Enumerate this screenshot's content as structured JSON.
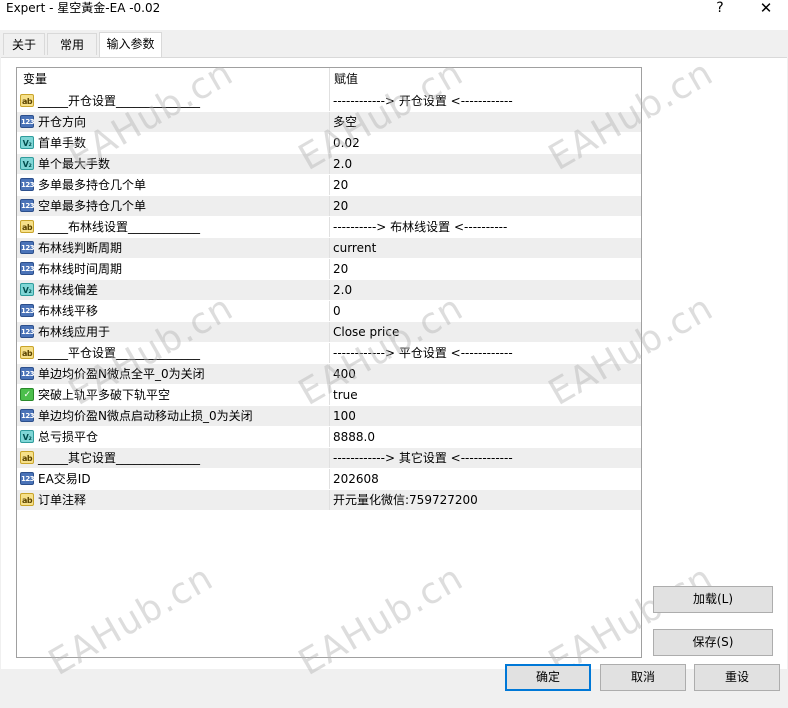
{
  "window": {
    "title": "Expert - 星空黃金-EA -0.02",
    "help_label": "?",
    "close_label": "✕"
  },
  "tabs": [
    {
      "label": "关于"
    },
    {
      "label": "常用"
    },
    {
      "label": "输入参数"
    }
  ],
  "grid": {
    "col_variable": "变量",
    "col_value": "赋值",
    "rows": [
      {
        "type": "ab",
        "icon_text": "ab",
        "name": "_____开仓设置______________",
        "value": "------------> 开仓设置 <------------"
      },
      {
        "type": "123",
        "icon_text": "123",
        "name": "开仓方向",
        "value": "多空"
      },
      {
        "type": "double",
        "icon_text": "V₂",
        "name": "首单手数",
        "value": "0.02"
      },
      {
        "type": "double",
        "icon_text": "V₂",
        "name": "单个最大手数",
        "value": "2.0"
      },
      {
        "type": "123",
        "icon_text": "123",
        "name": "多单最多持仓几个单",
        "value": "20"
      },
      {
        "type": "123",
        "icon_text": "123",
        "name": "空单最多持仓几个单",
        "value": "20"
      },
      {
        "type": "ab",
        "icon_text": "ab",
        "name": "_____布林线设置____________",
        "value": "----------> 布林线设置 <----------"
      },
      {
        "type": "123",
        "icon_text": "123",
        "name": "布林线判断周期",
        "value": "current"
      },
      {
        "type": "123",
        "icon_text": "123",
        "name": "布林线时间周期",
        "value": "20"
      },
      {
        "type": "double",
        "icon_text": "V₂",
        "name": "布林线偏差",
        "value": "2.0"
      },
      {
        "type": "123",
        "icon_text": "123",
        "name": "布林线平移",
        "value": "0"
      },
      {
        "type": "123",
        "icon_text": "123",
        "name": "布林线应用于",
        "value": "Close price"
      },
      {
        "type": "ab",
        "icon_text": "ab",
        "name": "_____平仓设置______________",
        "value": "------------> 平仓设置 <------------"
      },
      {
        "type": "123",
        "icon_text": "123",
        "name": "单边均价盈N微点全平_0为关闭",
        "value": "400"
      },
      {
        "type": "bool",
        "icon_text": "✓",
        "name": "突破上轨平多破下轨平空",
        "value": "true"
      },
      {
        "type": "123",
        "icon_text": "123",
        "name": "单边均价盈N微点启动移动止损_0为关闭",
        "value": "100"
      },
      {
        "type": "double",
        "icon_text": "V₂",
        "name": "总亏损平仓",
        "value": "8888.0"
      },
      {
        "type": "ab",
        "icon_text": "ab",
        "name": "_____其它设置______________",
        "value": "------------> 其它设置 <------------"
      },
      {
        "type": "123",
        "icon_text": "123",
        "name": "EA交易ID",
        "value": "202608"
      },
      {
        "type": "ab",
        "icon_text": "ab",
        "name": "订单注释",
        "value": "开元量化微信:759727200"
      }
    ]
  },
  "buttons": {
    "load": "加载(L)",
    "save": "保存(S)",
    "ok": "确定",
    "cancel": "取消",
    "reset": "重设"
  },
  "watermark": "EAHub.cn"
}
